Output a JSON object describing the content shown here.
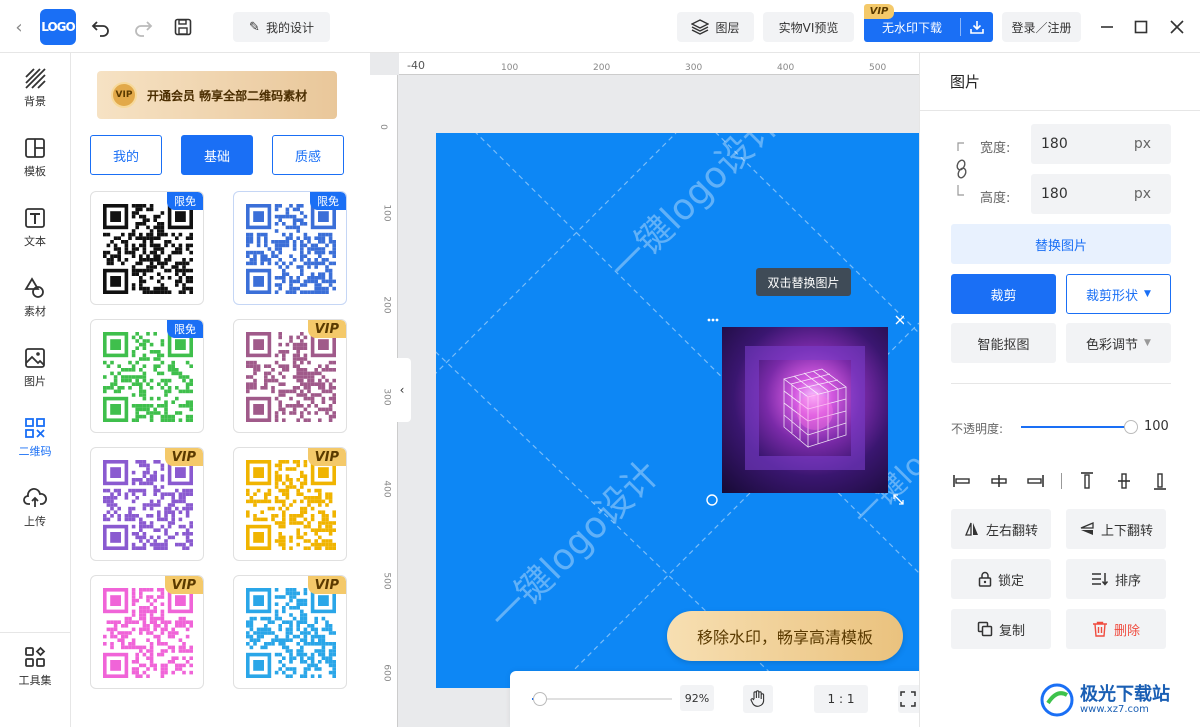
{
  "topbar": {
    "logo_text": "LOGO",
    "my_design": "我的设计",
    "layers": "图层",
    "vi_preview": "实物VI预览",
    "vip_tag": "VIP",
    "download": "无水印下载",
    "login": "登录／注册"
  },
  "nav": [
    {
      "label": "背景",
      "icon": "background-icon"
    },
    {
      "label": "模板",
      "icon": "template-icon"
    },
    {
      "label": "文本",
      "icon": "text-icon"
    },
    {
      "label": "素材",
      "icon": "material-icon"
    },
    {
      "label": "图片",
      "icon": "image-icon"
    },
    {
      "label": "二维码",
      "icon": "qrcode-icon",
      "active": true
    },
    {
      "label": "上传",
      "icon": "upload-icon"
    }
  ],
  "nav_bottom": {
    "label": "工具集",
    "icon": "tools-icon"
  },
  "panel": {
    "vip_banner": "开通会员 畅享全部二维码素材",
    "vip_badge": "VIP",
    "tabs": [
      "我的",
      "基础",
      "质感"
    ],
    "active_tab": 1,
    "items": [
      {
        "badge": "限免",
        "type": "free",
        "color": "#111111"
      },
      {
        "badge": "限免",
        "type": "free",
        "color": "#3b6fd8"
      },
      {
        "badge": "限免",
        "type": "free",
        "color": "#3fbf4c"
      },
      {
        "badge": "VIP",
        "type": "vip",
        "color": "#a05a8a"
      },
      {
        "badge": "VIP",
        "type": "vip",
        "color": "#8a5ad0"
      },
      {
        "badge": "VIP",
        "type": "vip",
        "color": "#f0b400"
      },
      {
        "badge": "VIP",
        "type": "vip",
        "color": "#f064d8"
      },
      {
        "badge": "VIP",
        "type": "vip",
        "color": "#2aa6e8"
      }
    ]
  },
  "canvas": {
    "ruler_top": [
      "-40",
      "100",
      "200",
      "300",
      "400",
      "500"
    ],
    "ruler_left": [
      "0",
      "100",
      "200",
      "300",
      "400",
      "500",
      "600"
    ],
    "watermark": "一键logo设计",
    "tooltip": "双击替换图片",
    "remove_watermark": "移除水印，畅享高清模板",
    "zoom": "92%",
    "zoom_level": 0.06,
    "ratio": "1 : 1",
    "artboard_color": "#0d87f5"
  },
  "right": {
    "title": "图片",
    "width_label": "宽度:",
    "width_value": "180",
    "height_label": "高度:",
    "height_value": "180",
    "unit": "px",
    "replace": "替换图片",
    "crop": "裁剪",
    "crop_shape": "裁剪形状",
    "smart_cutout": "智能抠图",
    "color_adjust": "色彩调节",
    "opacity_label": "不透明度:",
    "opacity_value": "100",
    "flip_h": "左右翻转",
    "flip_v": "上下翻转",
    "lock": "锁定",
    "order": "排序",
    "copy": "复制",
    "delete": "删除"
  },
  "watermark_site": "极光下载站",
  "watermark_url": "www.xz7.com",
  "colors": {
    "accent": "#1a6ff5",
    "vip": "#f4c96a",
    "danger": "#f04b3e"
  }
}
